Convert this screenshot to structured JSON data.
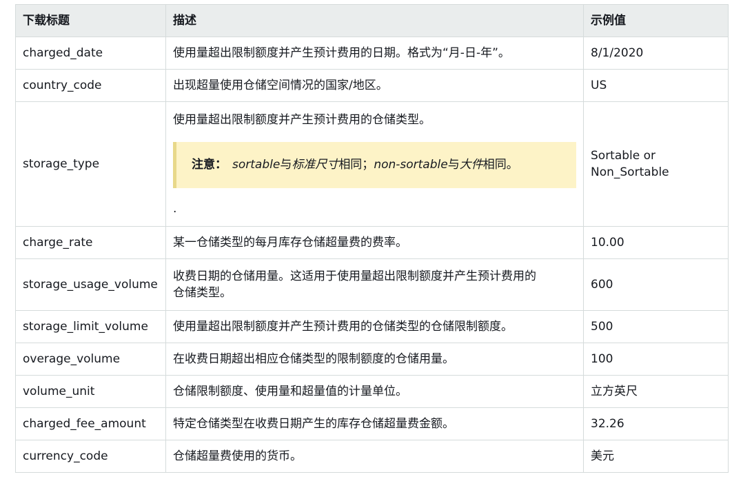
{
  "headers": [
    "下载标题",
    "描述",
    "示例值"
  ],
  "rows": [
    {
      "field": "charged_date",
      "desc": "使用量超出限制额度并产生预计费用的日期。格式为“月-日-年”。",
      "example": "8/1/2020"
    },
    {
      "field": "country_code",
      "desc": "出现超量使用仓储空间情况的国家/地区。",
      "example": "US"
    },
    {
      "field": "storage_type",
      "desc": "使用量超出限制额度并产生预计费用的仓储类型。",
      "example_line1": "Sortable or",
      "example_line2": "Non_Sortable",
      "note": {
        "label": "注意：",
        "t1": "sortable",
        "t2": "与",
        "t3": "标准尺寸",
        "t4": "相同；",
        "t5": "non-sortable",
        "t6": "与",
        "t7": "大件",
        "t8": "相同。"
      },
      "trailing": "."
    },
    {
      "field": "charge_rate",
      "desc": "某一仓储类型的每月库存仓储超量费的费率。",
      "example": "10.00"
    },
    {
      "field": "storage_usage_volume",
      "desc_line1": "收费日期的仓储用量。这适用于使用量超出限制额度并产生预计费用的",
      "desc_line2": "仓储类型。",
      "example": "600"
    },
    {
      "field": "storage_limit_volume",
      "desc": "使用量超出限制额度并产生预计费用的仓储类型的仓储限制额度。",
      "example": "500"
    },
    {
      "field": "overage_volume",
      "desc": "在收费日期超出相应仓储类型的限制额度的仓储用量。",
      "example": "100"
    },
    {
      "field": "volume_unit",
      "desc": "仓储限制额度、使用量和超量值的计量单位。",
      "example": "立方英尺"
    },
    {
      "field": "charged_fee_amount",
      "desc": "特定仓储类型在收费日期产生的库存仓储超量费金额。",
      "example": "32.26"
    },
    {
      "field": "currency_code",
      "desc": "仓储超量费使用的货币。",
      "example": "美元"
    }
  ],
  "colors": {
    "header_bg": "#eaeded",
    "border": "#d5dbdb",
    "note_bg": "#fdf3c7",
    "note_border": "#e8d88a"
  }
}
